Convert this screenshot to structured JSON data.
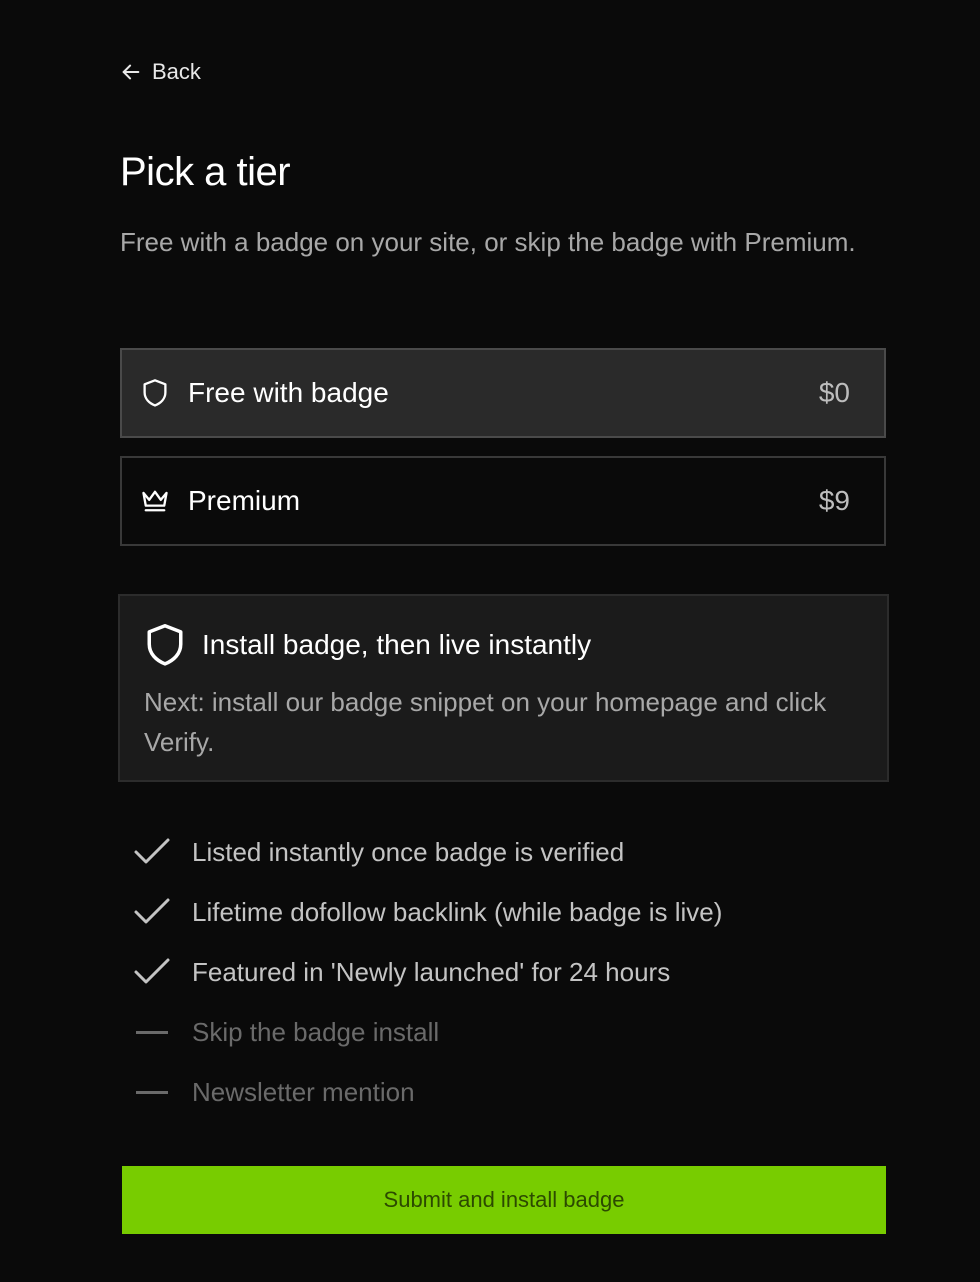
{
  "nav": {
    "back_label": "Back",
    "back_icon": "arrow-left-icon"
  },
  "header": {
    "title": "Pick a tier",
    "subtitle": "Free with a badge on your site, or skip the badge with Premium."
  },
  "tiers": [
    {
      "name": "Free with badge",
      "price": "$0",
      "icon": "shield-icon",
      "selected": true
    },
    {
      "name": "Premium",
      "price": "$9",
      "icon": "crown-icon",
      "selected": false
    }
  ],
  "info": {
    "icon": "shield-icon",
    "title": "Install badge, then live instantly",
    "body": "Next: install our badge snippet on your homepage and click Verify."
  },
  "features": [
    {
      "label": "Listed instantly once badge is verified",
      "included": true
    },
    {
      "label": "Lifetime dofollow backlink (while badge is live)",
      "included": true
    },
    {
      "label": "Featured in 'Newly launched' for 24 hours",
      "included": true
    },
    {
      "label": "Skip the badge install",
      "included": false
    },
    {
      "label": "Newsletter mention",
      "included": false
    }
  ],
  "submit": {
    "label": "Submit and install badge"
  },
  "colors": {
    "background": "#0a0a0a",
    "selected_tier_bg": "#2a2a2a",
    "info_bg": "#1b1b1b",
    "accent": "#78cc00",
    "muted_text": "#a8a8a8",
    "disabled_text": "#6a6a6a"
  }
}
